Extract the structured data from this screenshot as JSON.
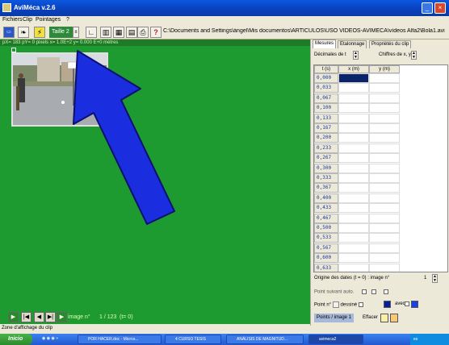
{
  "window": {
    "title": "AviMéca v.2.6",
    "minimize_icon": "minimize-icon",
    "close_icon": "close-icon"
  },
  "menu": {
    "items": [
      "Fichiers",
      "Clip",
      "Pointages",
      "?"
    ]
  },
  "toolbar": {
    "scale_label": "Taille 2",
    "path": "C:\\Documents and Settings\\ángel\\Mis documentos\\ARTÍCULOS\\USO VÍDEOS-AVIMECA\\vídeos Alfa2\\Bola1.avi"
  },
  "coordbar": {
    "text": "pX= 183  pY= 0 pixels   x= 1.0E+2  y= 0.000 E+0 mètres"
  },
  "playback": {
    "image_label": "image n°",
    "image_count": "1 / 123",
    "image_time": "(t= 0)"
  },
  "clip_label": "Zone d'affichage du clip",
  "panel": {
    "tabs": [
      "Mesures",
      "Etalonnage",
      "Propriétés du clip"
    ],
    "decimals_label": "Décimales de t",
    "digits_label": "Chiffres de x, y",
    "table": {
      "headers": [
        "t (s)",
        "x (m)",
        "y (m)"
      ],
      "times": [
        "0,000",
        "0,033",
        "0,067",
        "0,100",
        "0,133",
        "0,167",
        "0,200",
        "0,233",
        "0,267",
        "0,300",
        "0,333",
        "0,367",
        "0,400",
        "0,433",
        "0,467",
        "0,500",
        "0,533",
        "0,567",
        "0,600",
        "0,633"
      ]
    },
    "origin_label": "Origine des dates (t = 0) : image n°",
    "origin_value": "1",
    "auto_label": "Point suivant auto.",
    "point_label": "Point n°",
    "drawn_label": "dessiné",
    "with_label": "avec",
    "per_image_label": "Points / image",
    "per_image_value": "1",
    "clear_label": "Effacer"
  },
  "taskbar": {
    "start": "Inicio",
    "tasks": [
      "POR HACER.doc - Micros...",
      "4 CURSO TESIS",
      "ANÁLISIS DE MAGNITUD...",
      "avimeca2"
    ],
    "tray": "es"
  },
  "colors": {
    "video_bg": "#1e9b30",
    "arrow": "#1a2ee0",
    "titlebar": "#0a50d0"
  }
}
